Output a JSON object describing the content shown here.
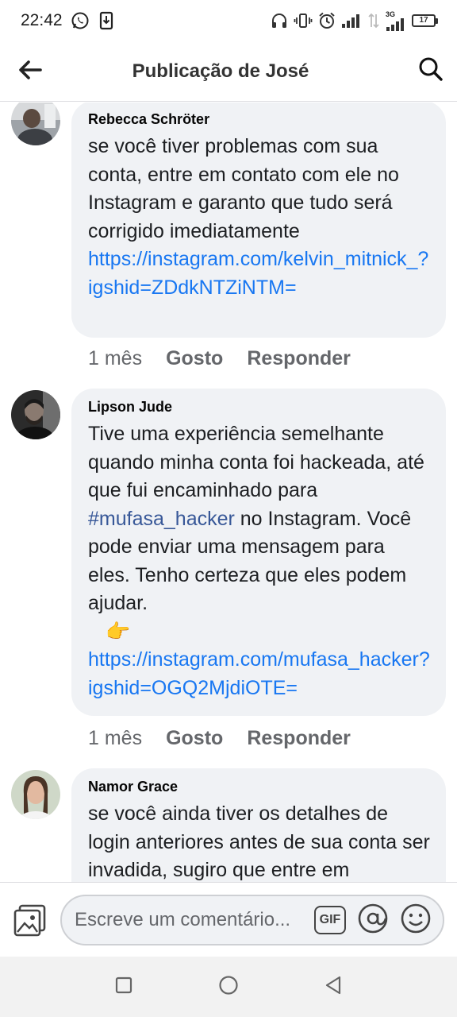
{
  "status_bar": {
    "time": "22:42",
    "network": "3G",
    "battery": "17",
    "icons": [
      "whatsapp-icon",
      "download-icon",
      "headphones-icon",
      "vibrate-icon",
      "alarm-icon",
      "signal-icon",
      "signal-icon",
      "battery-icon"
    ]
  },
  "header": {
    "title": "Publicação de José",
    "back_icon": "arrow-left-icon",
    "search_icon": "search-icon"
  },
  "comments": [
    {
      "author": "Rebecca Schröter",
      "text": "se você tiver problemas com sua conta, entre em contato com ele no Instagram e garanto que tudo será corrigido imediatamente ",
      "link": "https://instagram.com/kelvin_mitnick_?igshid=ZDdkNTZiNTM=",
      "link_display": "https://instagram.com/kelvin_mitnick_?igshid=ZDdkNTZiNTM=",
      "time": "1 mês",
      "like_label": "Gosto",
      "reply_label": "Responder"
    },
    {
      "author": "Lipson Jude",
      "text_before_tag": "Tive uma experiência semelhante quando minha conta foi hackeada, até que fui encaminhado para ",
      "hashtag": "#mufasa_hacker",
      "text_after_tag": " no Instagram. Você pode enviar uma mensagem para eles.  Tenho certeza que eles podem ajudar.",
      "emoji": "👉",
      "link_display": "https://instagram.com/mufasa_hacker?igshid=OGQ2MjdiOTE=",
      "time": "1 mês",
      "like_label": "Gosto",
      "reply_label": "Responder"
    },
    {
      "author": "Namor Grace",
      "text": "se você ainda tiver os detalhes de login anteriores antes de sua conta ser invadida, sugiro que entre em"
    }
  ],
  "composer": {
    "placeholder": "Escreve um comentário...",
    "gif_label": "GIF",
    "icons": [
      "photo-icon",
      "at-sign-icon",
      "emoji-icon"
    ]
  },
  "nav": {
    "icons": [
      "recent-apps-icon",
      "home-icon",
      "back-icon"
    ]
  }
}
